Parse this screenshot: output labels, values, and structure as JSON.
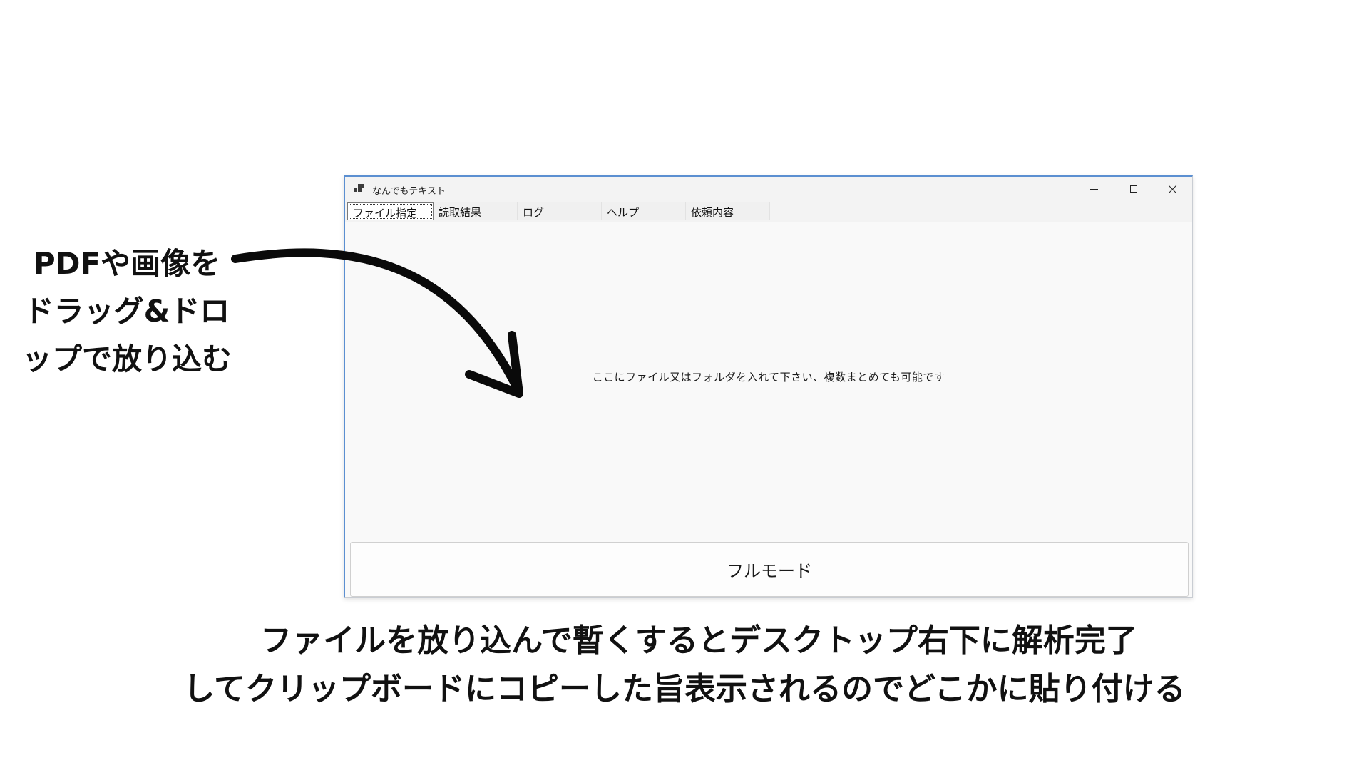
{
  "window": {
    "title": "なんでもテキスト",
    "controls": {
      "minimize": "minimize-icon",
      "maximize": "maximize-icon",
      "close": "close-icon"
    }
  },
  "tabs": [
    {
      "label": "ファイル指定",
      "active": true
    },
    {
      "label": "読取結果",
      "active": false
    },
    {
      "label": "ログ",
      "active": false
    },
    {
      "label": "ヘルプ",
      "active": false
    },
    {
      "label": "依頼内容",
      "active": false
    }
  ],
  "drop_area": {
    "hint": "ここにファイル又はフォルダを入れて下さい、複数まとめても可能です"
  },
  "full_mode_button": {
    "label": "フルモード"
  },
  "annotations": {
    "left": "PDFや画像を\nドラッグ&ドロ\nップで放り込む",
    "bottom_line1": "ファイルを放り込んで暫くするとデスクトップ右下に解析完了",
    "bottom_line2": "してクリップボードにコピーした旨表示されるのでどこかに貼り付ける"
  }
}
